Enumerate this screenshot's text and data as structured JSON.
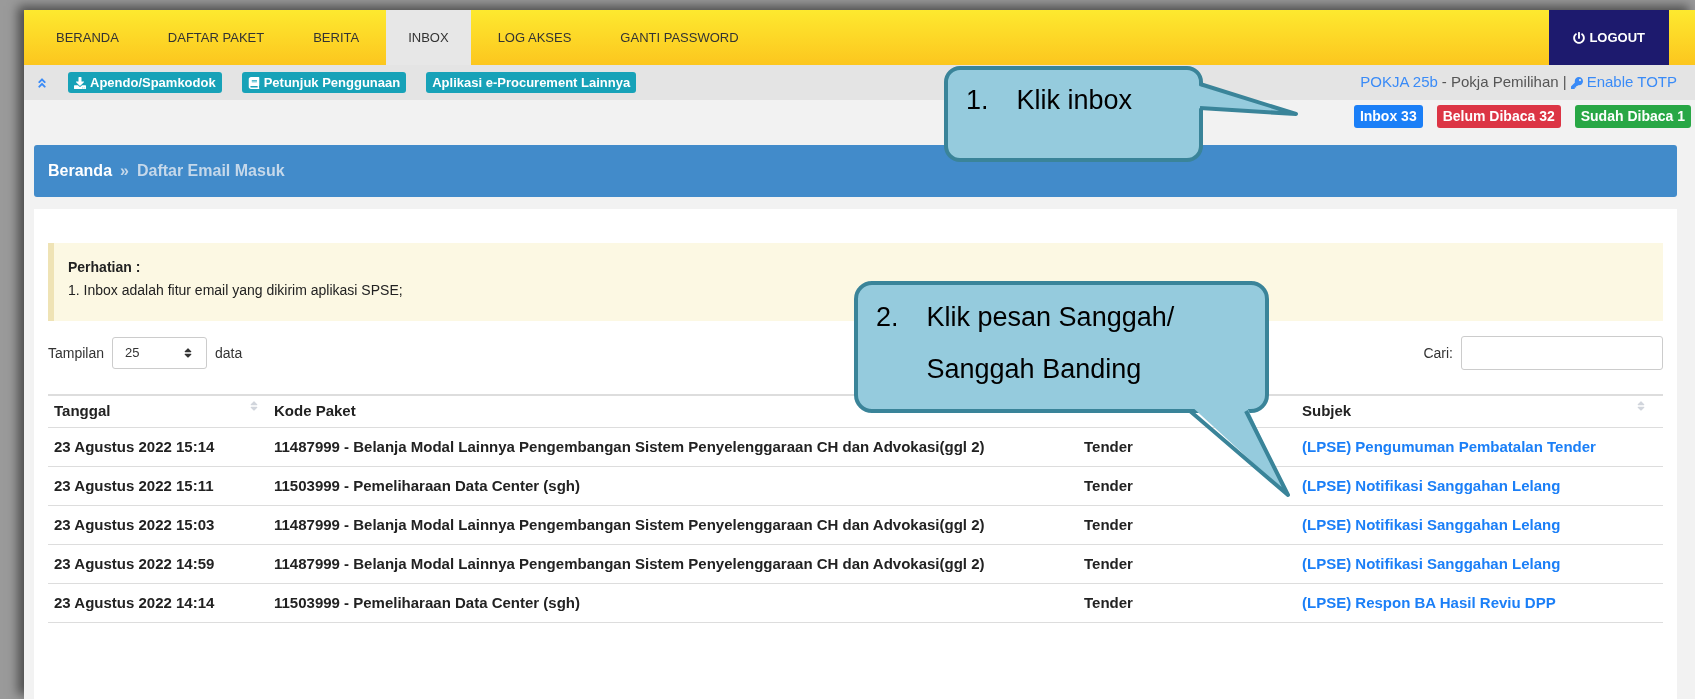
{
  "nav": {
    "items": [
      {
        "label": "BERANDA",
        "selected": false
      },
      {
        "label": "DAFTAR PAKET",
        "selected": false
      },
      {
        "label": "BERITA",
        "selected": false
      },
      {
        "label": "INBOX",
        "selected": true
      },
      {
        "label": "LOG AKSES",
        "selected": false
      },
      {
        "label": "GANTI PASSWORD",
        "selected": false
      }
    ],
    "logout": "LOGOUT"
  },
  "toolbar": {
    "buttons": [
      {
        "label": "Apendo/Spamkodok",
        "kind": "download"
      },
      {
        "label": "Petunjuk Penggunaan",
        "kind": "book"
      },
      {
        "label": "Aplikasi e-Procurement Lainnya",
        "kind": "plain"
      }
    ],
    "user": "POKJA 25b",
    "role": "- Pokja Pemilihan |",
    "totp": "Enable TOTP"
  },
  "badges": [
    {
      "label": "Inbox 33",
      "color": "#1b7ff7"
    },
    {
      "label": "Belum Dibaca 32",
      "color": "#dc3545"
    },
    {
      "label": "Sudah Dibaca 1",
      "color": "#28a745"
    }
  ],
  "breadcrumb": {
    "home": "Beranda",
    "separator": "»",
    "current": "Daftar Email Masuk"
  },
  "alert": {
    "title": "Perhatian :",
    "items": [
      "1. Inbox adalah fitur email yang dikirim aplikasi SPSE;"
    ]
  },
  "length": {
    "before": "Tampilan",
    "value": "25",
    "after": "data"
  },
  "search": {
    "label": "Cari:"
  },
  "table": {
    "columns": {
      "tanggal": "Tanggal",
      "kode_paket": "Kode Paket",
      "subjek": "Subjek"
    },
    "rows": [
      {
        "tanggal": "23 Agustus 2022 15:14",
        "kode_paket": "11487999 - Belanja Modal Lainnya Pengembangan Sistem Penyelenggaraan CH dan Advokasi(ggl 2)",
        "column_3": "Tender",
        "subjek": "(LPSE) Pengumuman Pembatalan Tender"
      },
      {
        "tanggal": "23 Agustus 2022 15:11",
        "kode_paket": "11503999 - Pemeliharaan Data Center (sgh)",
        "column_3": "Tender",
        "subjek": "(LPSE) Notifikasi Sanggahan Lelang"
      },
      {
        "tanggal": "23 Agustus 2022 15:03",
        "kode_paket": "11487999 - Belanja Modal Lainnya Pengembangan Sistem Penyelenggaraan CH dan Advokasi(ggl 2)",
        "column_3": "Tender",
        "subjek": "(LPSE) Notifikasi Sanggahan Lelang"
      },
      {
        "tanggal": "23 Agustus 2022 14:59",
        "kode_paket": "11487999 - Belanja Modal Lainnya Pengembangan Sistem Penyelenggaraan CH dan Advokasi(ggl 2)",
        "column_3": "Tender",
        "subjek": "(LPSE) Notifikasi Sanggahan Lelang"
      },
      {
        "tanggal": "23 Agustus 2022 14:14",
        "kode_paket": "11503999 - Pemeliharaan Data Center (sgh)",
        "column_3": "Tender",
        "subjek": "(LPSE) Respon BA Hasil Reviu DPP"
      }
    ]
  },
  "callouts": [
    {
      "number": "1.",
      "lines": [
        "Klik inbox"
      ]
    },
    {
      "number": "2.",
      "lines": [
        "Klik pesan Sanggah/",
        "Sanggah Banding"
      ]
    }
  ]
}
